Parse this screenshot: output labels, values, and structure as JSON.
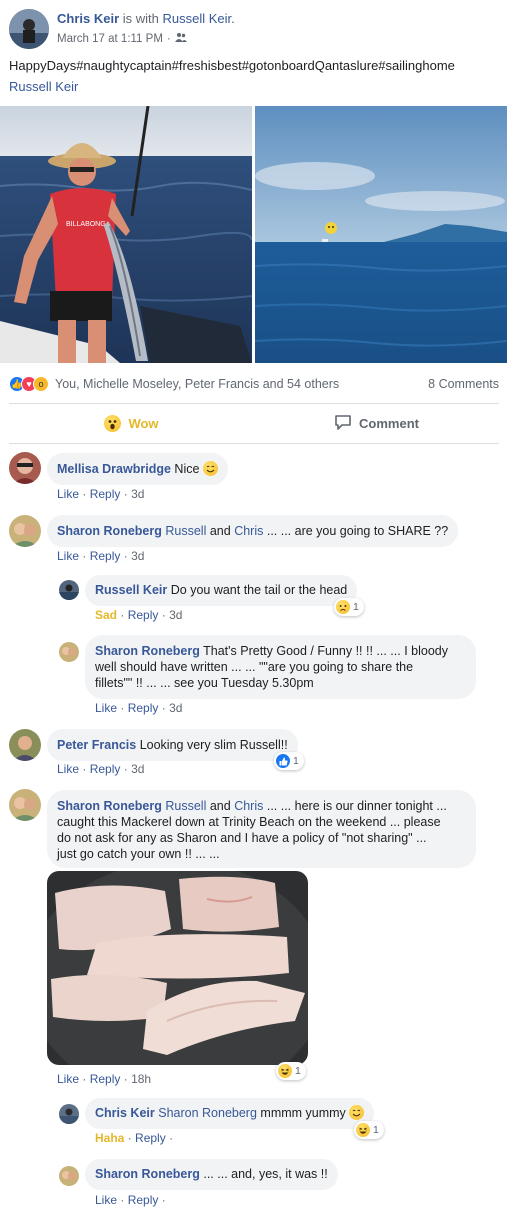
{
  "post": {
    "author": "Chris Keir",
    "with_text": "is with",
    "tagged": "Russell Keir.",
    "time": "March 17 at 1:11 PM",
    "separator": "·",
    "text": "HappyDays#naughtycaptain#freshisbest#gotonboardQantaslure#sailinghome",
    "tag_line": "Russell Keir",
    "privacy_icon": "friends-icon"
  },
  "reactions": {
    "summary": "You, Michelle Moseley, Peter Francis and 54 others",
    "comments_count": "8 Comments",
    "icons": [
      "like-icon",
      "love-icon",
      "wow-icon"
    ],
    "colors": {
      "like": "#1877f2",
      "love": "#f33e58",
      "wow": "#f7b928"
    }
  },
  "actions": {
    "wow": "Wow",
    "comment": "Comment"
  },
  "comments": [
    {
      "name": "Mellisa Drawbridge",
      "text": "Nice",
      "like": "Like",
      "reply": "Reply",
      "time": "3d"
    },
    {
      "name": "Sharon Roneberg",
      "tag1": "Russell",
      "mid": "and",
      "tag2": "Chris",
      "text": "... ... are you going to SHARE ??",
      "like": "Like",
      "reply": "Reply",
      "time": "3d",
      "replies": [
        {
          "name": "Russell Keir",
          "text": "Do you want the tail or the head",
          "reaction": "Sad",
          "reply": "Reply",
          "time": "3d",
          "badge_count": "1"
        },
        {
          "name": "Sharon Roneberg",
          "text_line1": "That's Pretty Good / Funny !! !! ... ... I bloody",
          "text_line2": "well should have written ... ... \"\"are you going to share the",
          "text_line3": "fillets\"\" !! ... ... see you Tuesday 5.30pm",
          "like": "Like",
          "reply": "Reply",
          "time": "3d"
        }
      ]
    },
    {
      "name": "Peter Francis",
      "text": "Looking very slim Russell!!",
      "like": "Like",
      "reply": "Reply",
      "time": "3d",
      "badge_count": "1"
    },
    {
      "name": "Sharon Roneberg",
      "tag1": "Russell",
      "mid": "and",
      "tag2": "Chris",
      "text_line1": "... ... here is our dinner tonight ...",
      "text_line2": "caught this Mackerel down at Trinity Beach on the weekend ... please",
      "text_line3": "do not ask for any as Sharon and I have a policy of \"not sharing\" ...",
      "text_line4": "just go catch your own !! ... ...",
      "like": "Like",
      "reply": "Reply",
      "time": "18h",
      "badge_count": "1",
      "replies": [
        {
          "name": "Chris Keir",
          "tag": "Sharon Roneberg",
          "text": "mmmm yummy",
          "reaction": "Haha",
          "reply": "Reply",
          "badge_count": "1"
        },
        {
          "name": "Sharon Roneberg",
          "text": "... ... and, yes, it was !!",
          "like": "Like",
          "reply": "Reply"
        }
      ]
    }
  ],
  "dot": "·"
}
